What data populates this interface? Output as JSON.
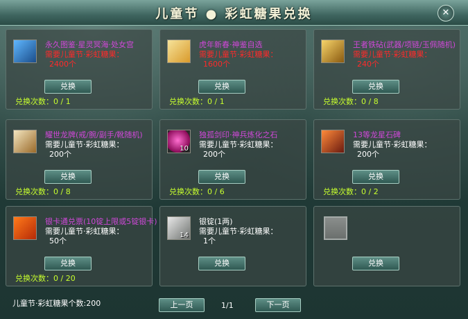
{
  "window": {
    "title": "儿童节 ● 彩虹糖果兑换",
    "close_icon": "x-close-icon"
  },
  "items": [
    {
      "name": "永久图鉴·星灵冥海·处女宫",
      "name_color": "#cf48d8",
      "req": "需要儿童节·彩虹糖果：",
      "req_color": "#ff2a2a",
      "amount": "2400个",
      "amount_color": "#ff2a2a",
      "button": "兑换",
      "times": "兑换次数：0 / 1",
      "count": "",
      "icon": "zodiac-virgo-icon"
    },
    {
      "name": "虎年新春·神鉴自选",
      "name_color": "#cf48d8",
      "req": "需要儿童节·彩虹糖果：",
      "req_color": "#ff2a2a",
      "amount": "1600个",
      "amount_color": "#ff2a2a",
      "button": "兑换",
      "times": "兑换次数：0 / 1",
      "count": "",
      "icon": "gift-box-icon"
    },
    {
      "name": "王者铁砧(武器/项链/玉佩随机)",
      "name_color": "#cf48d8",
      "req": "需要儿童节·彩虹糖果：",
      "req_color": "#ff2a2a",
      "amount": "240个",
      "amount_color": "#ff2a2a",
      "button": "兑换",
      "times": "兑换次数：0 / 8",
      "count": "",
      "icon": "golden-anvil-icon"
    },
    {
      "name": "耀世龙牌(戒/腕/副手/靴随机)",
      "name_color": "#cf48d8",
      "req": "需要儿童节·彩虹糖果：",
      "req_color": "#ffffff",
      "amount": "200个",
      "amount_color": "#ffffff",
      "button": "兑换",
      "times": "兑换次数：0 / 8",
      "count": "",
      "icon": "dragon-plaque-icon"
    },
    {
      "name": "独孤剑印·神兵炼化之石",
      "name_color": "#cf48d8",
      "req": "需要儿童节·彩虹糖果：",
      "req_color": "#ffffff",
      "amount": "200个",
      "amount_color": "#ffffff",
      "button": "兑换",
      "times": "兑换次数：0 / 6",
      "count": "10",
      "icon": "pink-gem-icon"
    },
    {
      "name": "13等龙星石碑",
      "name_color": "#cf48d8",
      "req": "需要儿童节·彩虹糖果：",
      "req_color": "#ffffff",
      "amount": "200个",
      "amount_color": "#ffffff",
      "button": "兑换",
      "times": "兑换次数：0 / 2",
      "count": "",
      "icon": "dragon-star-stone-icon"
    },
    {
      "name": "银卡通兑票(10锭上限或5锭银卡)",
      "name_color": "#cf48d8",
      "req": "需要儿童节·彩虹糖果：",
      "req_color": "#ffffff",
      "amount": "50个",
      "amount_color": "#ffffff",
      "button": "兑换",
      "times": "兑换次数：0 / 20",
      "count": "",
      "icon": "exchange-ticket-icon"
    },
    {
      "name": "银锭(1两)",
      "name_color": "#ffffff",
      "req": "需要儿童节·彩虹糖果：",
      "req_color": "#ffffff",
      "amount": "1个",
      "amount_color": "#ffffff",
      "button": "兑换",
      "times": "",
      "count": "14",
      "icon": "silver-ingot-icon"
    },
    {
      "name": "",
      "name_color": "#ffffff",
      "req": "",
      "req_color": "#ffffff",
      "amount": "",
      "amount_color": "#ffffff",
      "button": "兑换",
      "times": "",
      "count": "",
      "icon": "empty-slot-icon"
    }
  ],
  "footer": {
    "currency": "儿童节·彩虹糖果个数:200",
    "prev": "上一页",
    "page": "1/1",
    "next": "下一页"
  }
}
